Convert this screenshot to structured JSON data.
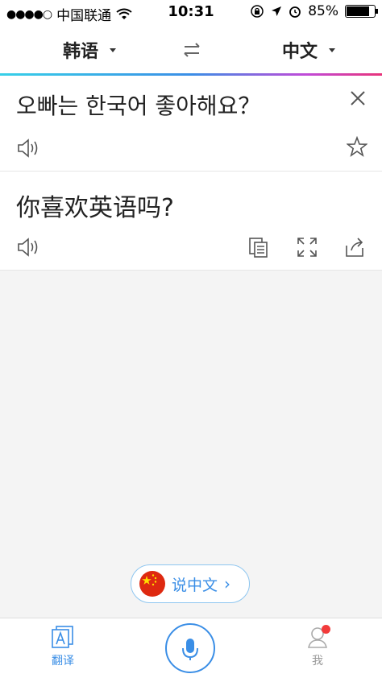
{
  "status": {
    "carrier": "中国联通",
    "time": "10:31",
    "battery": "85%",
    "battery_level": 0.85
  },
  "languages": {
    "source": "韩语",
    "target": "中文"
  },
  "input": {
    "text": "오빠는 한국어 좋아해요？"
  },
  "result": {
    "text": "你喜欢英语吗?"
  },
  "speak_button": {
    "label": "说中文"
  },
  "tabs": {
    "translate": "翻译",
    "me": "我"
  },
  "colors": {
    "accent": "#3a8ee6",
    "badge": "#f23b3b",
    "flag_red": "#de2910",
    "flag_star": "#ffde00"
  },
  "icons": [
    "wifi-icon",
    "lock-rotation-icon",
    "location-icon",
    "alarm-icon",
    "battery-icon",
    "swap-icon",
    "close-icon",
    "speaker-icon",
    "star-icon",
    "copy-icon",
    "fullscreen-icon",
    "share-icon",
    "china-flag-icon",
    "microphone-icon",
    "translate-tab-icon",
    "user-icon"
  ]
}
